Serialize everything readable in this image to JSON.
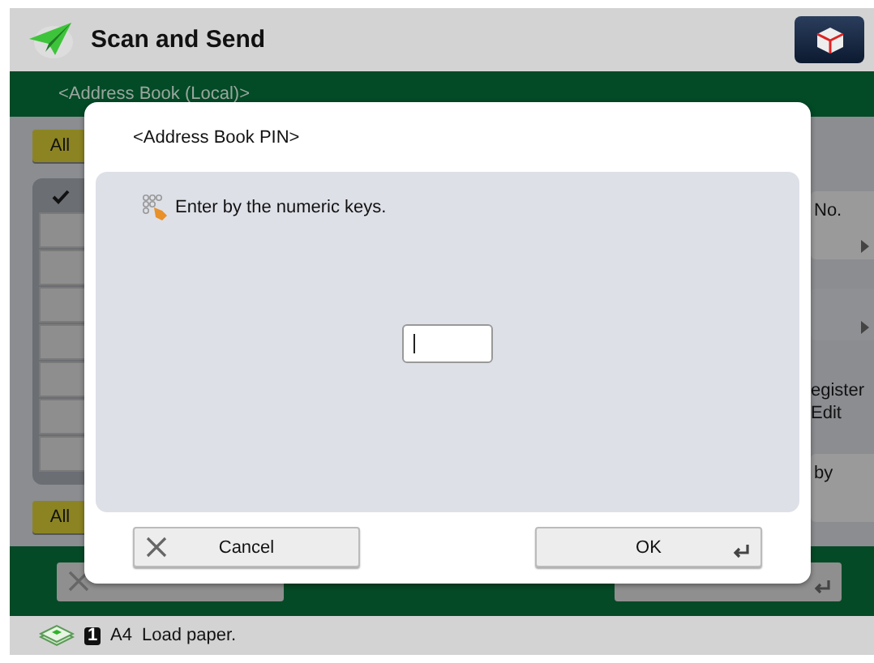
{
  "header": {
    "title": "Scan and Send"
  },
  "band": {
    "title": "<Address Book (Local)>"
  },
  "left": {
    "top_button": "All",
    "bottom_button": "All"
  },
  "right": [
    {
      "kind": "arrow_button",
      "label": "No."
    },
    {
      "kind": "blank"
    },
    {
      "kind": "text",
      "lines": [
        "egister",
        "Edit"
      ]
    },
    {
      "kind": "button",
      "label": "by"
    }
  ],
  "footer_buttons": [
    {
      "kind": "cancel"
    },
    {
      "kind": "ok"
    }
  ],
  "status_bar": {
    "tray": "1",
    "paper": "A4",
    "message": "Load paper."
  },
  "dialog": {
    "title": "<Address Book PIN>",
    "hint": "Enter by the numeric keys.",
    "buttons": [
      {
        "kind": "cancel",
        "label": "Cancel"
      },
      {
        "kind": "ok",
        "label": "OK"
      }
    ]
  }
}
